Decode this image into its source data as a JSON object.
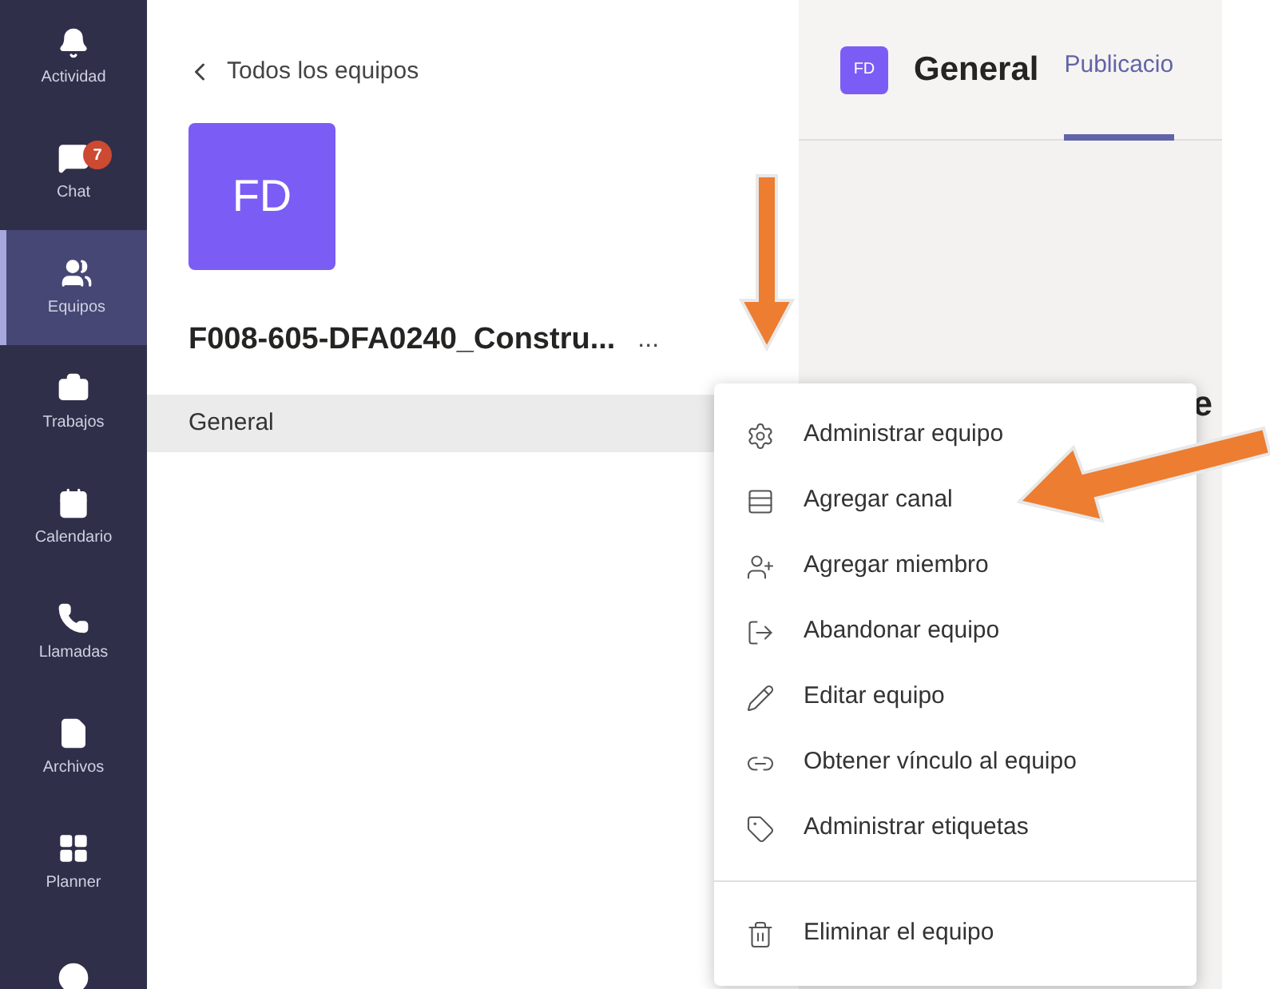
{
  "rail": {
    "items": [
      {
        "label": "Actividad",
        "selected": false
      },
      {
        "label": "Chat",
        "selected": false,
        "badge": "7"
      },
      {
        "label": "Equipos",
        "selected": true
      },
      {
        "label": "Trabajos",
        "selected": false
      },
      {
        "label": "Calendario",
        "selected": false
      },
      {
        "label": "Llamadas",
        "selected": false
      },
      {
        "label": "Archivos",
        "selected": false
      },
      {
        "label": "Planner",
        "selected": false
      },
      {
        "selected": false
      }
    ]
  },
  "teams_panel": {
    "back_link": "Todos los equipos",
    "team_avatar": "FD",
    "team_name": "F008-605-DFA0240_Constru...",
    "more_button": "...",
    "channels": [
      {
        "name": "General",
        "selected": true
      }
    ]
  },
  "channel_header": {
    "avatar": "FD",
    "title": "General",
    "tabs": [
      {
        "label": "Publicacio",
        "selected": true
      }
    ],
    "cut_heading": "e"
  },
  "menu": {
    "items": [
      {
        "label": "Administrar equipo",
        "kind": "gear"
      },
      {
        "label": "Agregar canal",
        "kind": "channel"
      },
      {
        "label": "Agregar miembro",
        "kind": "add-person"
      },
      {
        "label": "Abandonar equipo",
        "kind": "leave"
      },
      {
        "label": "Editar equipo",
        "kind": "pencil"
      },
      {
        "label": "Obtener vínculo al equipo",
        "kind": "link"
      },
      {
        "label": "Administrar etiquetas",
        "kind": "tag"
      },
      {
        "label": "Eliminar el equipo",
        "kind": "trash",
        "separated": true
      }
    ]
  }
}
